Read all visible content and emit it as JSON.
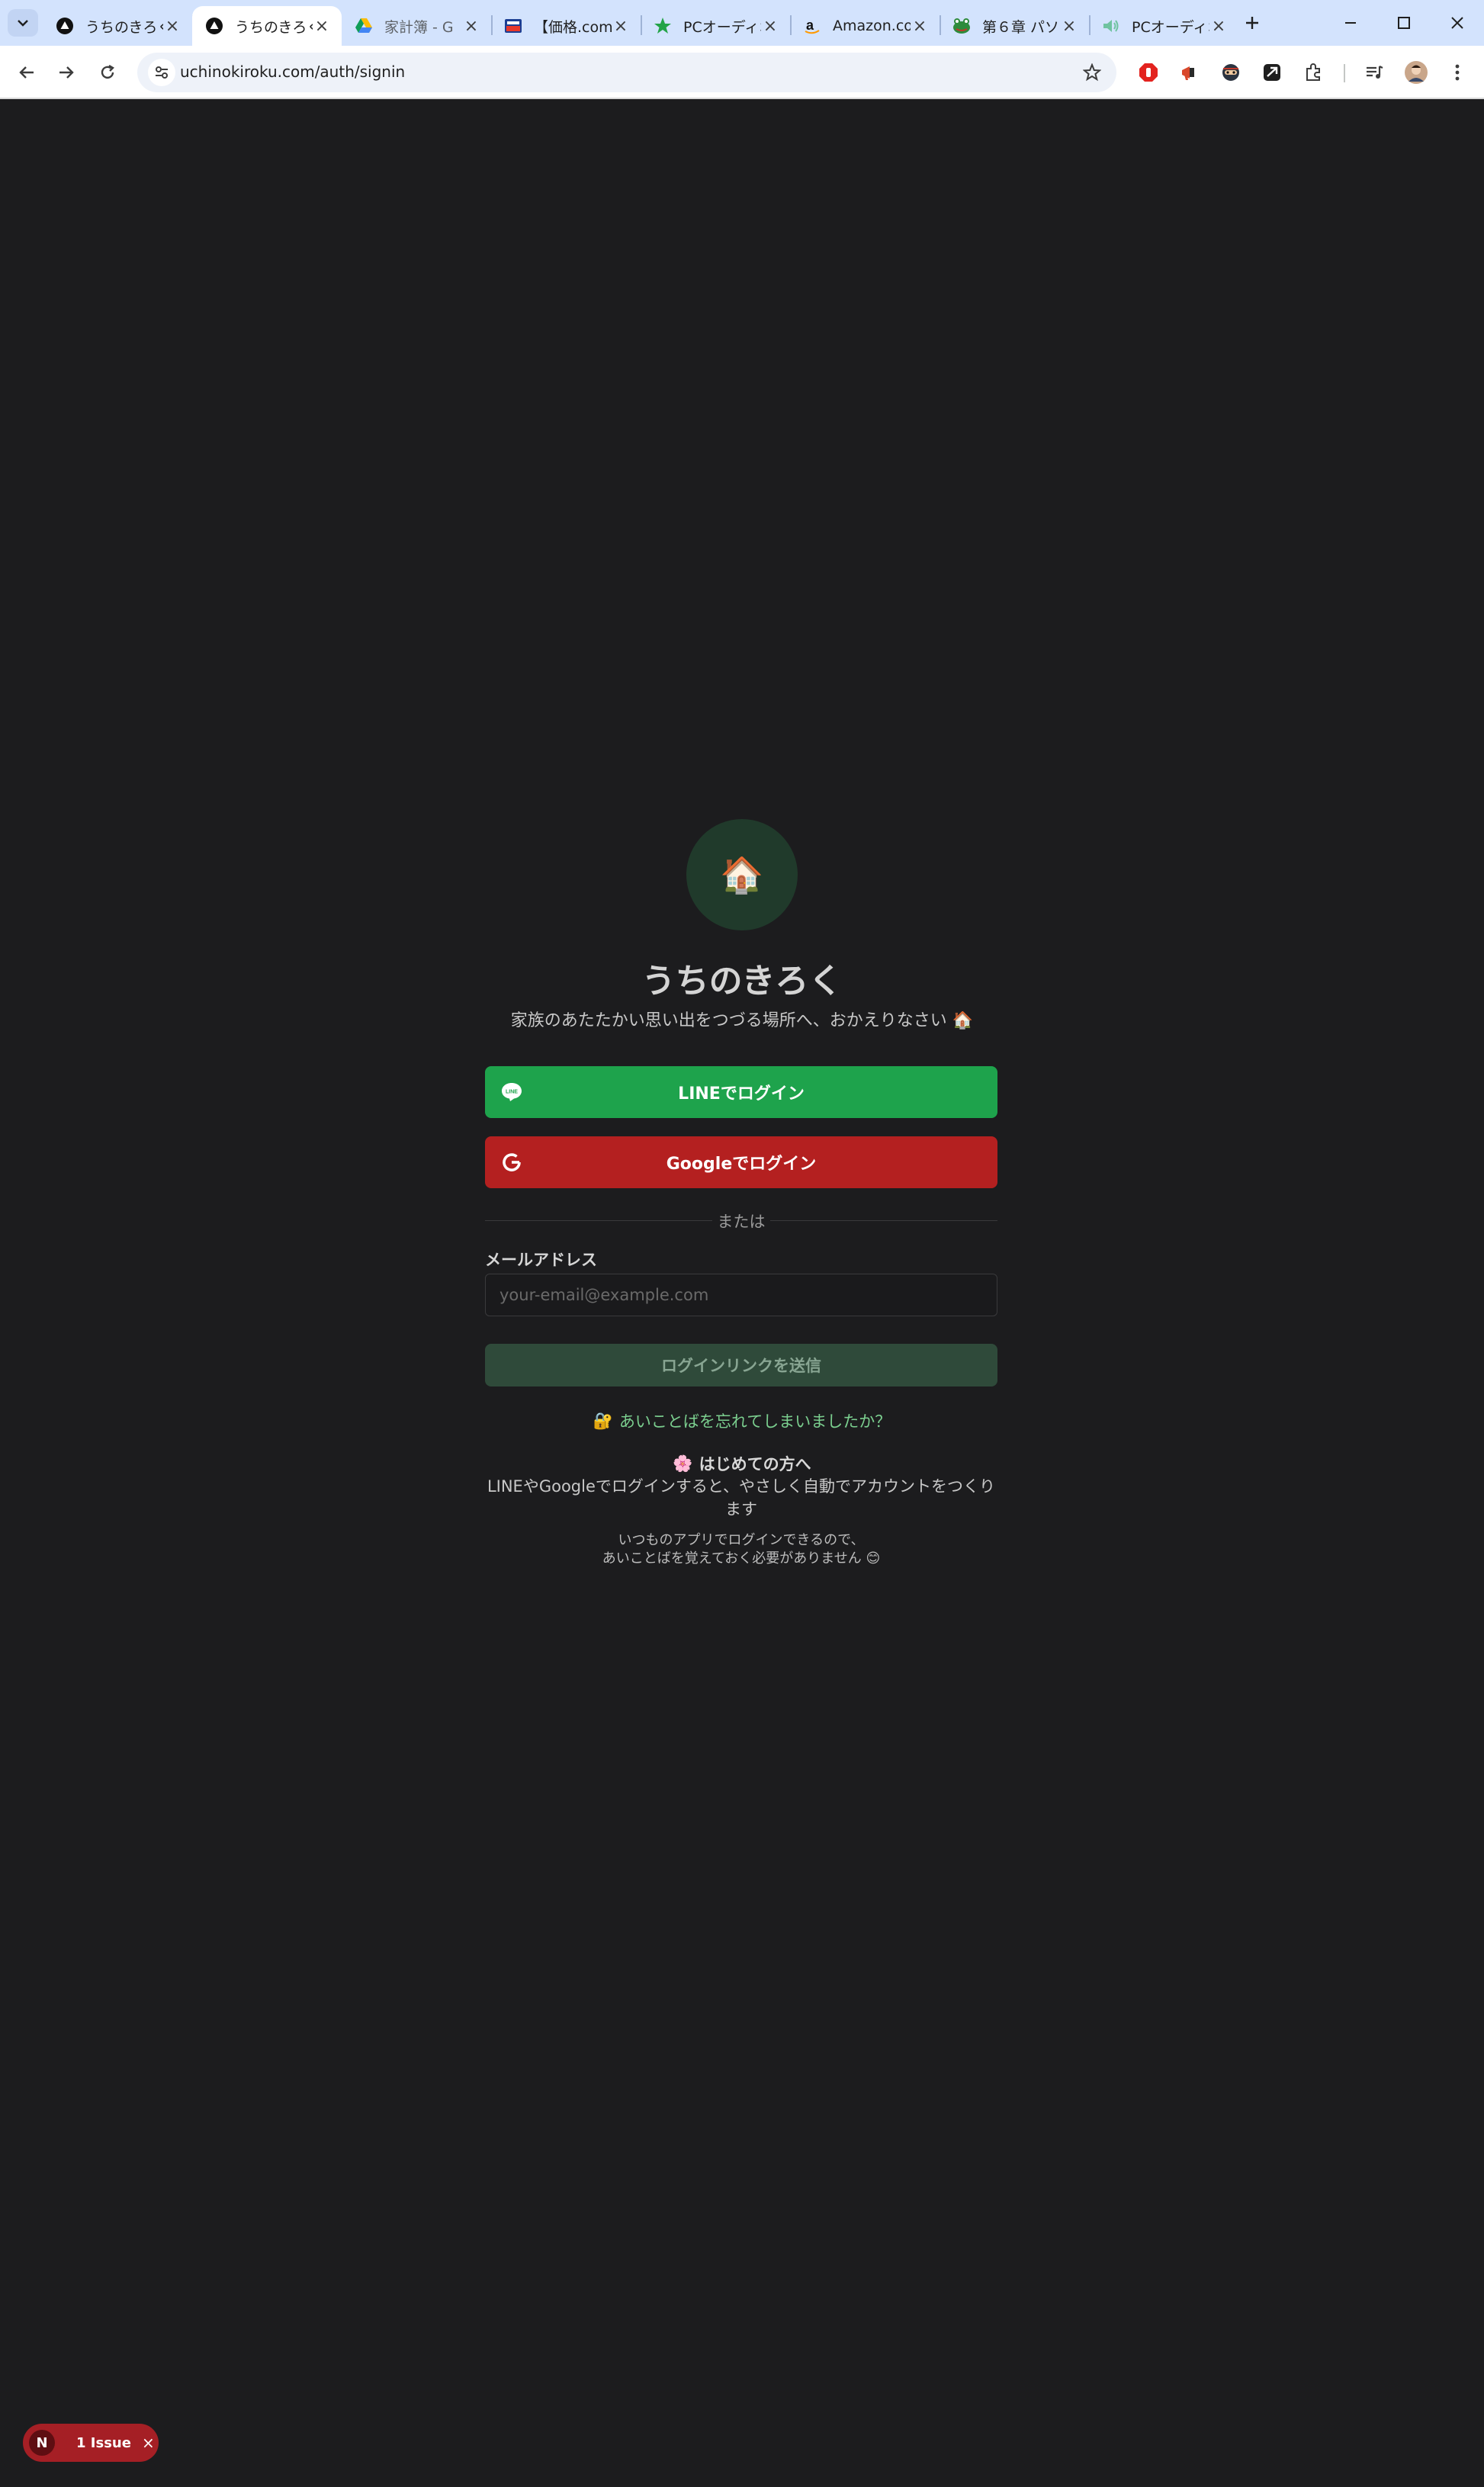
{
  "browser": {
    "tabs": [
      {
        "title": "うちのきろく",
        "favicon": "triangle-icon",
        "active": false
      },
      {
        "title": "うちのきろく",
        "favicon": "triangle-icon",
        "active": true
      },
      {
        "title": "家計簿 - G",
        "favicon": "drive-icon",
        "active": false
      },
      {
        "title": "【価格.com】",
        "favicon": "kakaku-icon",
        "active": false
      },
      {
        "title": "PCオーディオ",
        "favicon": "star-icon",
        "active": false
      },
      {
        "title": "Amazon.co",
        "favicon": "amazon-icon",
        "active": false
      },
      {
        "title": "第６章 パソ",
        "favicon": "frog-icon",
        "active": false
      },
      {
        "title": "PCオーディオ",
        "favicon": "speaker-icon",
        "active": false
      }
    ],
    "url": "uchinokiroku.com/auth/signin"
  },
  "signin": {
    "logo_emoji": "🏠",
    "title": "うちのきろく",
    "subtitle": "家族のあたたかい思い出をつづる場所へ、おかえりなさい 🏠",
    "line_button": "LINEでログイン",
    "line_icon_text": "LINE",
    "google_button": "Googleでログイン",
    "divider": "または",
    "email_label": "メールアドレス",
    "email_placeholder": "your-email@example.com",
    "send_button": "ログインリンクを送信",
    "forgot_emoji": "🔐",
    "forgot_text": "あいことばを忘れてしまいましたか？",
    "first_time_emoji": "🌸",
    "first_time_title": "はじめての方へ",
    "first_time_desc": "LINEやGoogleでログインすると、やさしく自動でアカウントをつくります",
    "note_line1": "いつものアプリでログインできるので、",
    "note_line2": "あいことばを覚えておく必要がありません 😊"
  },
  "devtools": {
    "badge_letter": "N",
    "issue_label": "1 Issue"
  },
  "colors": {
    "line_green": "#1ea34c",
    "google_red": "#b42020",
    "accent_green": "#7bcf8f",
    "background": "#1c1c1e"
  }
}
